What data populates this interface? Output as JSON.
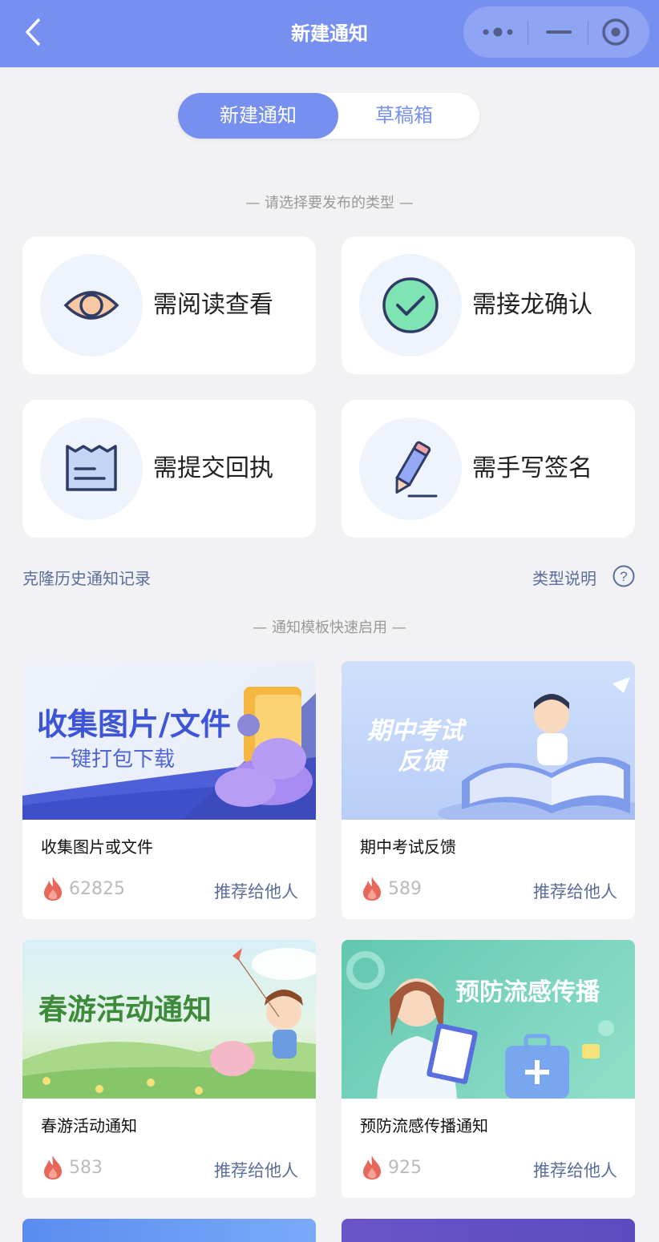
{
  "header": {
    "title": "新建通知"
  },
  "tabs": [
    {
      "label": "新建通知",
      "active": true
    },
    {
      "label": "草稿箱",
      "active": false
    }
  ],
  "type_section": {
    "title": "— 请选择要发布的类型 —"
  },
  "types": [
    {
      "label": "需阅读查看",
      "icon": "eye-icon"
    },
    {
      "label": "需接龙确认",
      "icon": "check-circle-icon"
    },
    {
      "label": "需提交回执",
      "icon": "receipt-icon"
    },
    {
      "label": "需手写签名",
      "icon": "pencil-icon"
    }
  ],
  "links": {
    "clone": "克隆历史通知记录",
    "type_help": "类型说明"
  },
  "template_section": {
    "title": "— 通知模板快速启用 —"
  },
  "templates": [
    {
      "name": "收集图片或文件",
      "count": "62825",
      "recommend": "推荐给他人",
      "banner_line1": "收集图片/文件",
      "banner_line2": "一键打包下载"
    },
    {
      "name": "期中考试反馈",
      "count": "589",
      "recommend": "推荐给他人",
      "banner_line1": "期中考试",
      "banner_line2": "反馈"
    },
    {
      "name": "春游活动通知",
      "count": "583",
      "recommend": "推荐给他人",
      "banner_line1": "春游活动通知"
    },
    {
      "name": "预防流感传播通知",
      "count": "925",
      "recommend": "推荐给他人",
      "banner_line1": "预防流感传播"
    }
  ],
  "colors": {
    "primary": "#7790f0",
    "link": "#5b6e9a",
    "fire": "#e8675b"
  }
}
